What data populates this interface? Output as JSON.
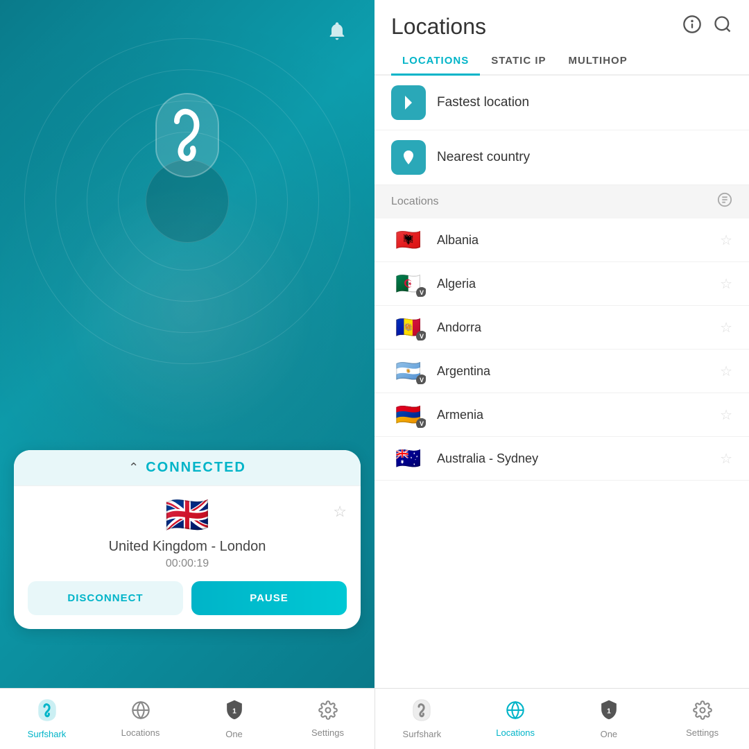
{
  "left": {
    "notification_icon": "🔔",
    "connected_label": "CONNECTED",
    "flag": "🇬🇧",
    "location_name": "United Kingdom - London",
    "timer": "00:00:19",
    "disconnect_label": "DISCONNECT",
    "pause_label": "PAUSE",
    "star_icon": "☆"
  },
  "right": {
    "title": "Locations",
    "tabs": [
      {
        "id": "locations",
        "label": "LOCATIONS",
        "active": true
      },
      {
        "id": "static_ip",
        "label": "STATIC IP",
        "active": false
      },
      {
        "id": "multihop",
        "label": "MULTIHOP",
        "active": false
      }
    ],
    "quick_items": [
      {
        "id": "fastest",
        "icon": "⚡",
        "label": "Fastest location"
      },
      {
        "id": "nearest",
        "icon": "📍",
        "label": "Nearest country"
      }
    ],
    "section_title": "Locations",
    "countries": [
      {
        "name": "Albania",
        "flag": "🇦🇱",
        "has_badge": false
      },
      {
        "name": "Algeria",
        "flag": "🇩🇿",
        "has_badge": true
      },
      {
        "name": "Andorra",
        "flag": "🇦🇩",
        "has_badge": true
      },
      {
        "name": "Argentina",
        "flag": "🇦🇷",
        "has_badge": true
      },
      {
        "name": "Armenia",
        "flag": "🇦🇲",
        "has_badge": true
      },
      {
        "name": "Australia - Sydney",
        "flag": "🇦🇺",
        "has_badge": false
      }
    ]
  },
  "bottom_nav_left": [
    {
      "id": "surfshark",
      "icon": "surfshark",
      "label": "Surfshark",
      "active": true
    },
    {
      "id": "locations",
      "icon": "globe",
      "label": "Locations",
      "active": false
    },
    {
      "id": "one",
      "icon": "shield",
      "label": "One",
      "active": false,
      "badge": "1"
    },
    {
      "id": "settings",
      "icon": "gear",
      "label": "Settings",
      "active": false
    }
  ],
  "bottom_nav_right": [
    {
      "id": "surfshark",
      "icon": "surfshark",
      "label": "Surfshark",
      "active": false
    },
    {
      "id": "locations",
      "icon": "globe",
      "label": "Locations",
      "active": true
    },
    {
      "id": "one",
      "icon": "shield",
      "label": "One",
      "active": false,
      "badge": "1"
    },
    {
      "id": "settings",
      "icon": "gear",
      "label": "Settings",
      "active": false
    }
  ]
}
